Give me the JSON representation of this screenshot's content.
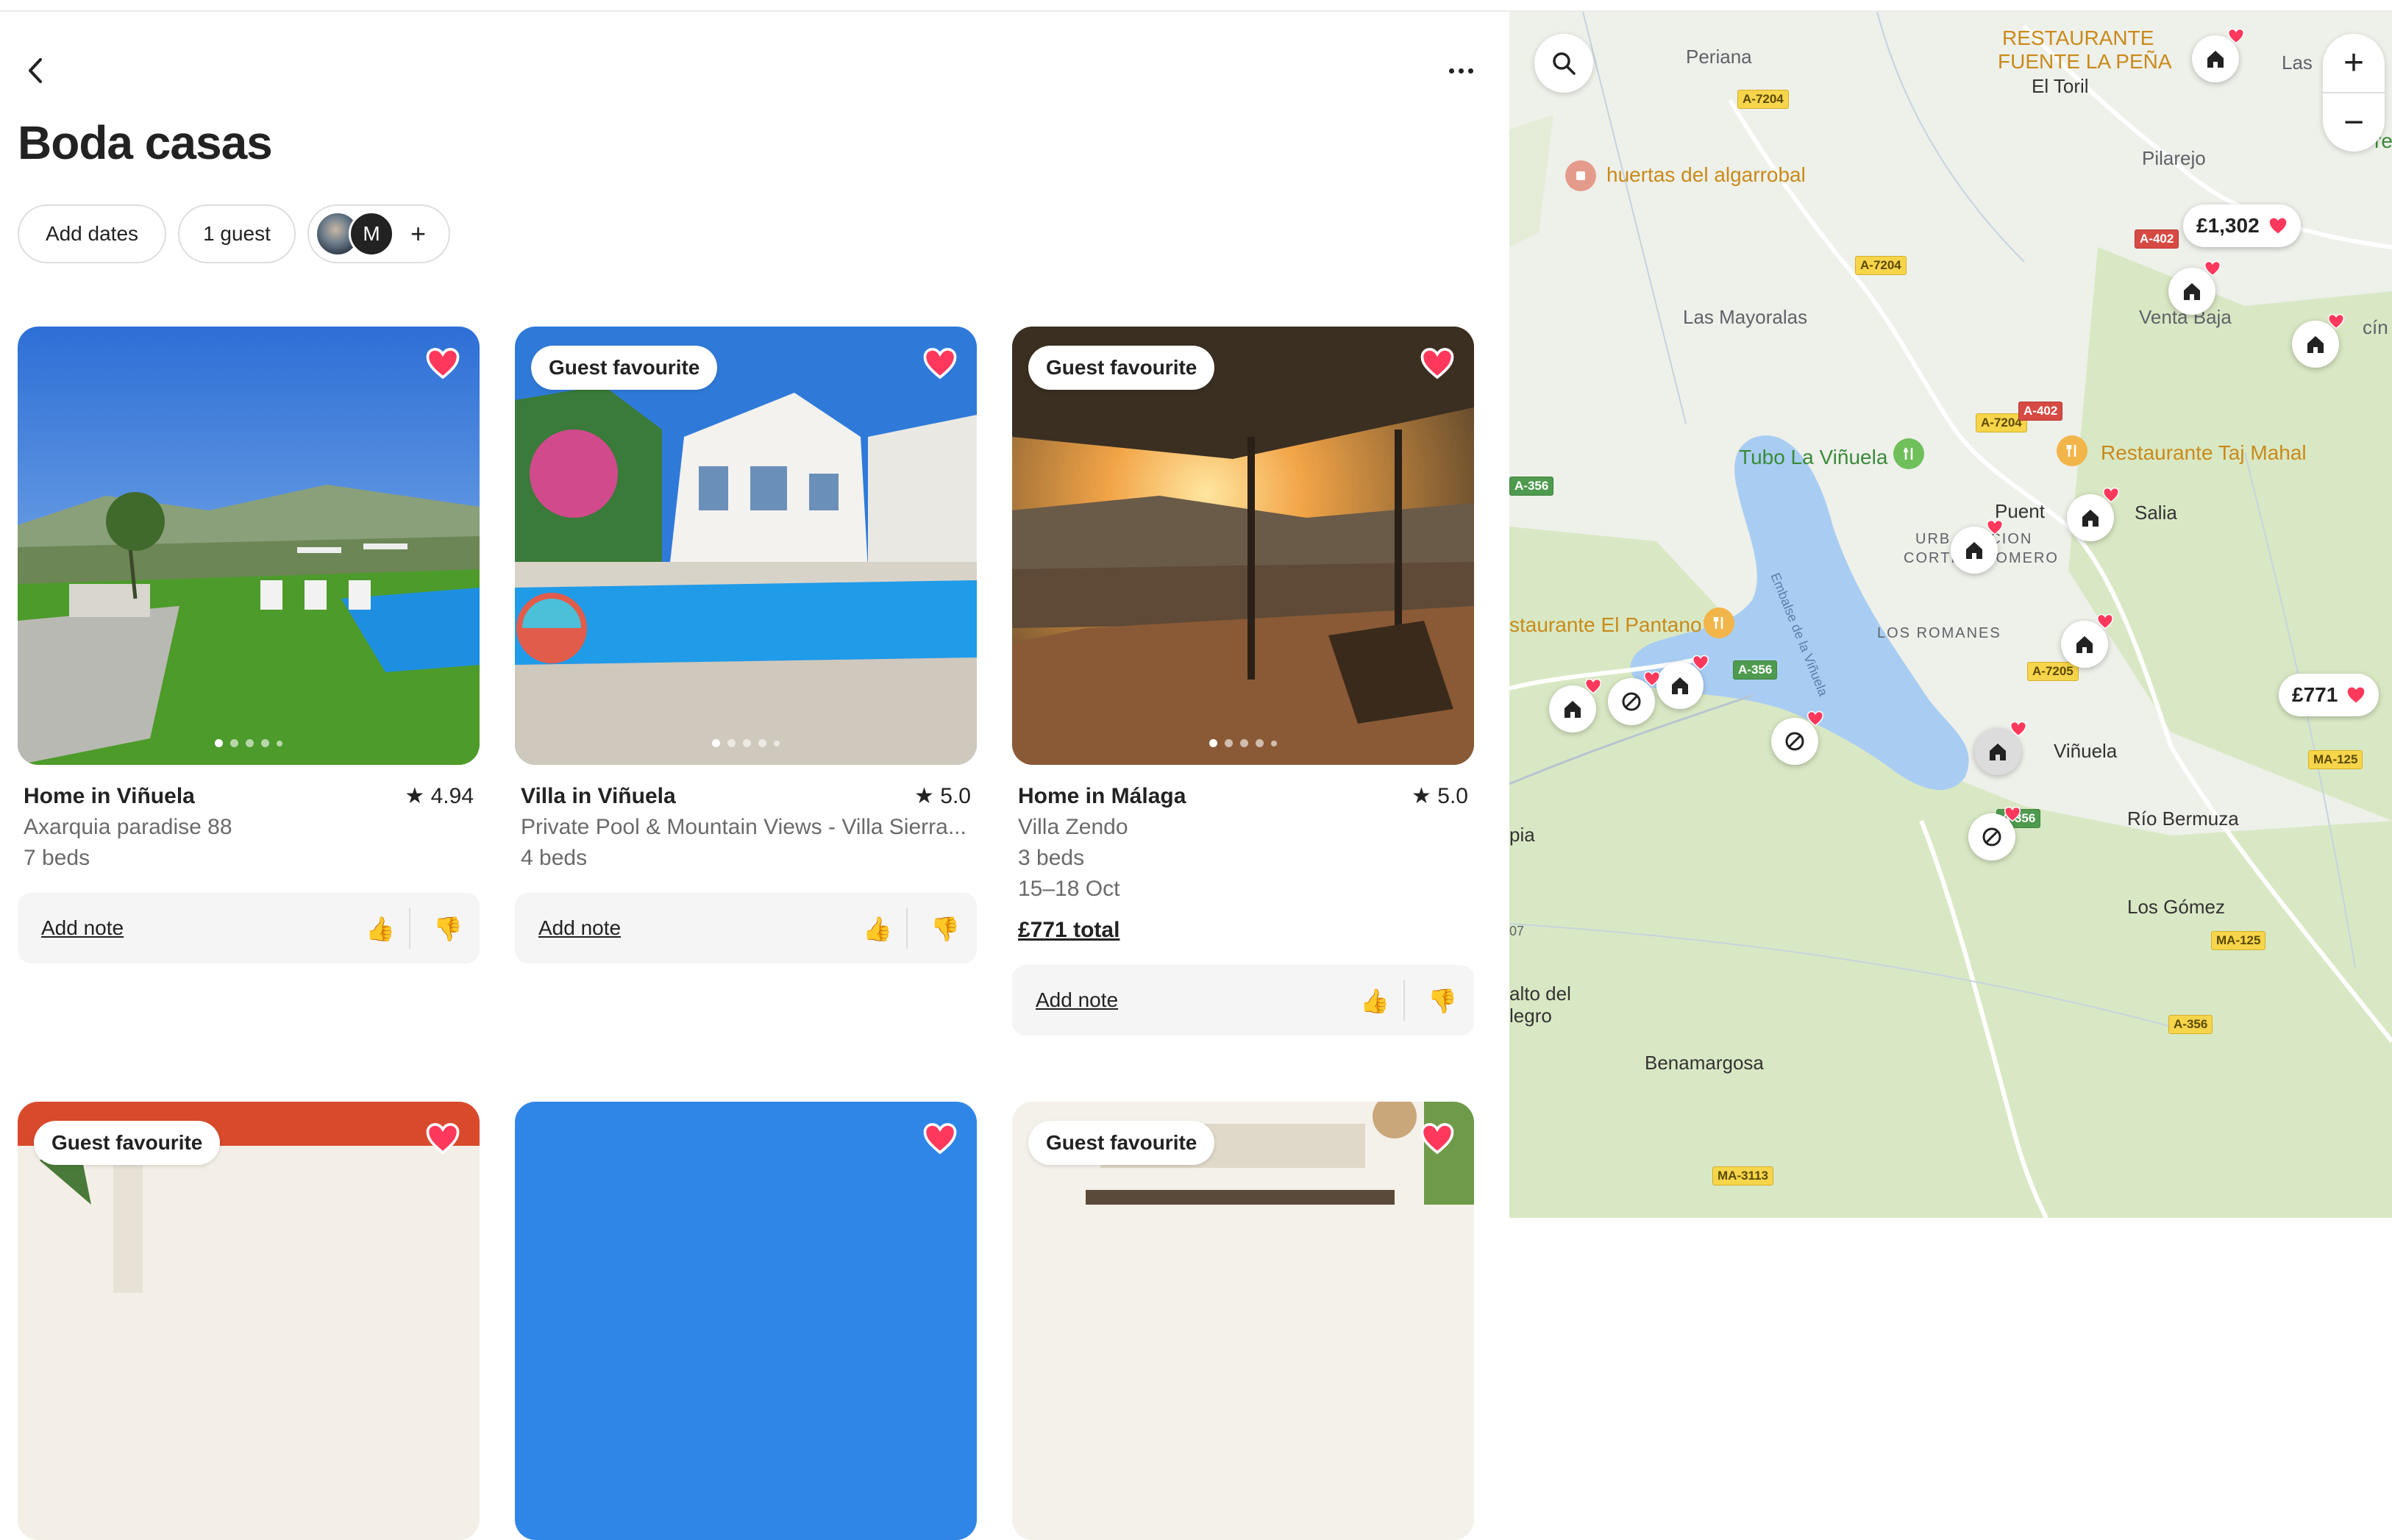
{
  "wishlist": {
    "title": "Boda casas",
    "add_dates_label": "Add dates",
    "guests_label": "1 guest",
    "avatar_letter": "M",
    "add_collaborator_symbol": "+"
  },
  "listings": [
    {
      "badge": "",
      "type": "Home in Viñuela",
      "rating": "4.94",
      "subtitle": "Axarquia paradise 88",
      "beds": "7 beds",
      "dates": "",
      "price": "",
      "note_label": "Add note",
      "thumb_up": "👍",
      "thumb_down": "👎",
      "photo_dots": 5,
      "saved": true
    },
    {
      "badge": "Guest favourite",
      "type": "Villa in Viñuela",
      "rating": "5.0",
      "subtitle": "Private Pool & Mountain Views - Villa Sierra...",
      "beds": "4 beds",
      "dates": "",
      "price": "",
      "note_label": "Add note",
      "thumb_up": "👍",
      "thumb_down": "👎",
      "photo_dots": 5,
      "saved": true
    },
    {
      "badge": "Guest favourite",
      "type": "Home in Málaga",
      "rating": "5.0",
      "subtitle": "Villa Zendo",
      "beds": "3 beds",
      "dates": "15–18 Oct",
      "price": "£771 total",
      "note_label": "Add note",
      "thumb_up": "👍",
      "thumb_down": "👎",
      "photo_dots": 5,
      "saved": true
    },
    {
      "badge": "Guest favourite",
      "saved": true
    },
    {
      "badge": "",
      "saved": true
    },
    {
      "badge": "Guest favourite",
      "saved": true
    }
  ],
  "map": {
    "places": [
      "Periana",
      "RESTAURANTE",
      "FUENTE LA PEÑA",
      "El Toril",
      "Las",
      "huertas del algarrobal",
      "Pilarejo",
      "Las Mayoralas",
      "Venta Baja",
      "cín",
      "Tubo La Viñuela",
      "Restaurante Taj Mahal",
      "Puent",
      "Salia",
      "URB. ...ACION",
      "CORTIJO ROMERO",
      "staurante El Pantano",
      "LOS ROMANES",
      "Embalse de la Viñuela",
      "Viñuela",
      "Río Bermuza",
      "Los Gómez",
      "pia",
      "alto del",
      "legro",
      "Benamargosa",
      "07",
      "re"
    ],
    "roads": [
      "A-7204",
      "A-7204",
      "A-7204",
      "A-402",
      "A-402",
      "A-356",
      "A-356",
      "A-356",
      "A-356",
      "A-7205",
      "MA-125",
      "MA-125",
      "MA-3113"
    ],
    "price_pins": [
      "£1,302",
      "£771"
    ],
    "zoom_in": "+",
    "zoom_out": "−",
    "colors": {
      "water": "#a9cdf2",
      "land_green": "#d9e8c4",
      "land": "#eef0ea",
      "heart": "#ff385c"
    }
  }
}
